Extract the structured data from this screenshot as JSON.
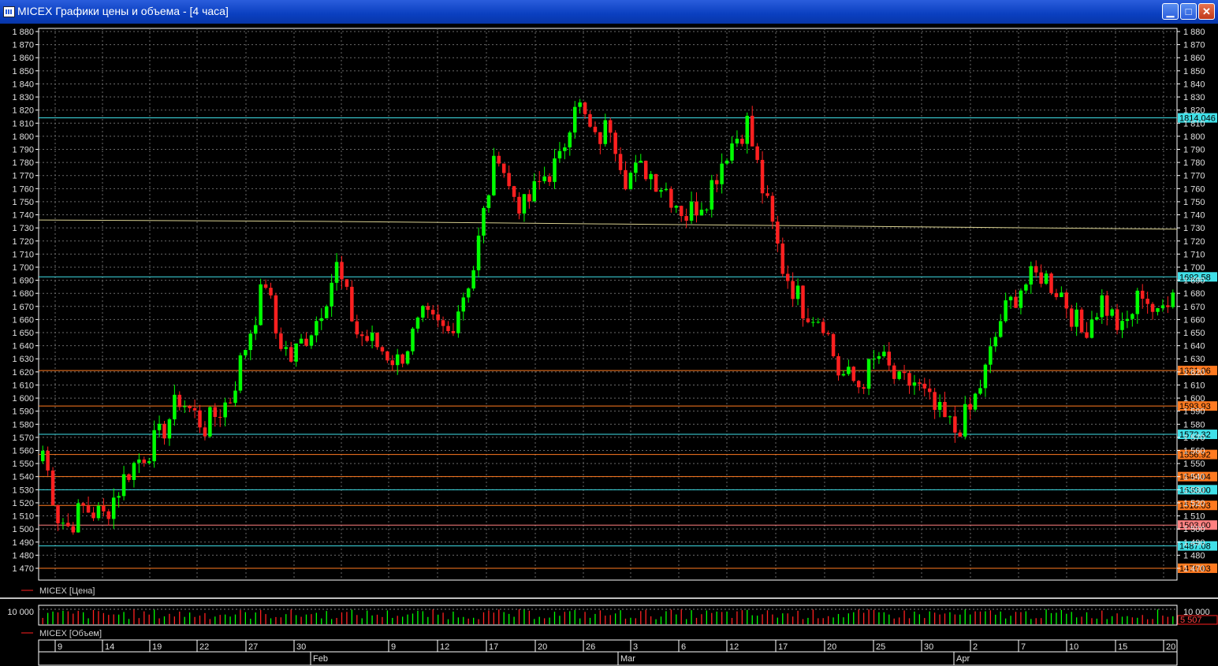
{
  "window": {
    "title": "MICEX Графики цены и объема - [4 часа]",
    "minimize_glyph": "▁",
    "maximize_glyph": "□",
    "close_glyph": "✕"
  },
  "price_panel": {
    "legend": "MICEX [Цена]",
    "y_ticks": [
      1470,
      1480,
      1490,
      1500,
      1510,
      1520,
      1530,
      1540,
      1550,
      1560,
      1570,
      1580,
      1590,
      1600,
      1610,
      1620,
      1630,
      1640,
      1650,
      1660,
      1670,
      1680,
      1690,
      1700,
      1710,
      1720,
      1730,
      1740,
      1750,
      1760,
      1770,
      1780,
      1790,
      1800,
      1810,
      1820,
      1830,
      1840,
      1850,
      1860,
      1870,
      1880
    ],
    "level_lines": [
      {
        "label": "1814.046",
        "value": 1814.046,
        "color": "#40e0e8"
      },
      {
        "label": "1692.58",
        "value": 1692.58,
        "color": "#40e0e8"
      },
      {
        "label": "1621.06",
        "value": 1621.06,
        "color": "#ff7a20"
      },
      {
        "label": "1593.93",
        "value": 1593.93,
        "color": "#ff7a20"
      },
      {
        "label": "1572.32",
        "value": 1572.32,
        "color": "#40e0e8"
      },
      {
        "label": "1556.92",
        "value": 1556.92,
        "color": "#ff7a20"
      },
      {
        "label": "1540.04",
        "value": 1540.04,
        "color": "#ff7a20"
      },
      {
        "label": "1530.00",
        "value": 1530.0,
        "color": "#40e0e8"
      },
      {
        "label": "1518.03",
        "value": 1518.03,
        "color": "#ff7a20"
      },
      {
        "label": "1503.00",
        "value": 1503.0,
        "color": "#ff8080"
      },
      {
        "label": "1487.08",
        "value": 1487.08,
        "color": "#40e0e8"
      },
      {
        "label": "1470.03",
        "value": 1470.03,
        "color": "#ff7a20"
      }
    ],
    "moving_average": {
      "color": "#d8d090",
      "points": [
        [
          0,
          1736
        ],
        [
          0.25,
          1735
        ],
        [
          0.5,
          1733
        ],
        [
          0.75,
          1731
        ],
        [
          1.0,
          1729
        ]
      ]
    },
    "up_color": "#00ff00",
    "down_color": "#ff2020"
  },
  "volume_panel": {
    "legend": "MICEX [Объем]",
    "left_label": "10 000",
    "right_label": "10 000",
    "current_label": "5 507"
  },
  "x_axis": {
    "day_labels": [
      "9",
      "14",
      "19",
      "22",
      "27",
      "30",
      "9",
      "12",
      "17",
      "20",
      "26",
      "3",
      "6",
      "12",
      "17",
      "20",
      "25",
      "30",
      "2",
      "7",
      "10",
      "15",
      "20"
    ],
    "month_labels": [
      "Feb",
      "Mar",
      "Apr"
    ]
  },
  "chart_data": {
    "type": "candlestick",
    "title": "MICEX Графики цены и объема - [4 часа]",
    "ylim": [
      1465,
      1885
    ],
    "anchors": [
      [
        0,
        1560
      ],
      [
        3,
        1510
      ],
      [
        5,
        1502
      ],
      [
        8,
        1516
      ],
      [
        12,
        1510
      ],
      [
        17,
        1545
      ],
      [
        23,
        1570
      ],
      [
        27,
        1600
      ],
      [
        32,
        1578
      ],
      [
        37,
        1600
      ],
      [
        40,
        1640
      ],
      [
        44,
        1690
      ],
      [
        46,
        1650
      ],
      [
        49,
        1630
      ],
      [
        54,
        1660
      ],
      [
        58,
        1700
      ],
      [
        62,
        1650
      ],
      [
        66,
        1640
      ],
      [
        70,
        1628
      ],
      [
        75,
        1660
      ],
      [
        80,
        1650
      ],
      [
        85,
        1700
      ],
      [
        88,
        1760
      ],
      [
        90,
        1790
      ],
      [
        92,
        1760
      ],
      [
        95,
        1745
      ],
      [
        99,
        1770
      ],
      [
        102,
        1780
      ],
      [
        105,
        1830
      ],
      [
        109,
        1795
      ],
      [
        112,
        1810
      ],
      [
        115,
        1770
      ],
      [
        119,
        1775
      ],
      [
        123,
        1760
      ],
      [
        127,
        1740
      ],
      [
        131,
        1755
      ],
      [
        135,
        1790
      ],
      [
        139,
        1810
      ],
      [
        142,
        1760
      ],
      [
        146,
        1700
      ],
      [
        150,
        1670
      ],
      [
        154,
        1660
      ],
      [
        157,
        1620
      ],
      [
        161,
        1610
      ],
      [
        165,
        1632
      ],
      [
        169,
        1610
      ],
      [
        172,
        1612
      ],
      [
        176,
        1590
      ],
      [
        180,
        1575
      ],
      [
        183,
        1590
      ],
      [
        186,
        1620
      ],
      [
        189,
        1660
      ],
      [
        193,
        1685
      ],
      [
        197,
        1695
      ],
      [
        201,
        1680
      ],
      [
        205,
        1650
      ],
      [
        209,
        1675
      ],
      [
        213,
        1650
      ],
      [
        217,
        1683
      ],
      [
        220,
        1660
      ],
      [
        223,
        1688
      ]
    ],
    "candle_count": 224,
    "volume_typical": 10000,
    "volume_last": 5507
  }
}
